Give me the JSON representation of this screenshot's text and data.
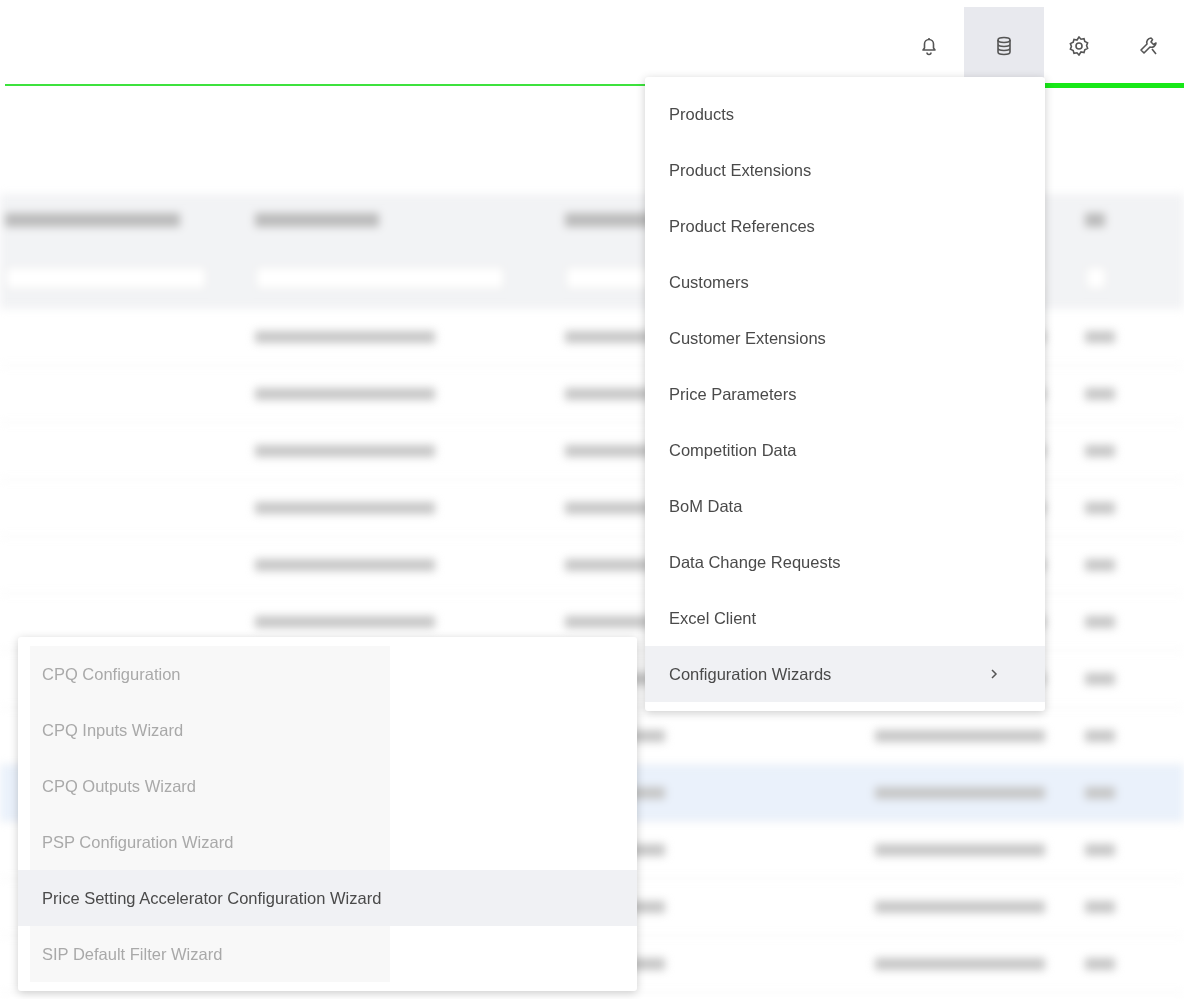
{
  "toolbar": {
    "icons": [
      {
        "kind": "bell",
        "selected": false
      },
      {
        "kind": "database",
        "selected": true
      },
      {
        "kind": "gear",
        "selected": false
      },
      {
        "kind": "wrench",
        "selected": false
      }
    ]
  },
  "data_menu": {
    "items": [
      {
        "label": "Products",
        "selected": false,
        "submenu": false
      },
      {
        "label": "Product Extensions",
        "selected": false,
        "submenu": false
      },
      {
        "label": "Product References",
        "selected": false,
        "submenu": false
      },
      {
        "label": "Customers",
        "selected": false,
        "submenu": false
      },
      {
        "label": "Customer Extensions",
        "selected": false,
        "submenu": false
      },
      {
        "label": "Price Parameters",
        "selected": false,
        "submenu": false
      },
      {
        "label": "Competition Data",
        "selected": false,
        "submenu": false
      },
      {
        "label": "BoM Data",
        "selected": false,
        "submenu": false
      },
      {
        "label": "Data Change Requests",
        "selected": false,
        "submenu": false
      },
      {
        "label": "Excel Client",
        "selected": false,
        "submenu": false
      },
      {
        "label": "Configuration Wizards",
        "selected": true,
        "submenu": true
      }
    ]
  },
  "wizards_menu": {
    "items": [
      {
        "label": "CPQ Configuration",
        "selected": false,
        "disabled": true
      },
      {
        "label": "CPQ Inputs Wizard",
        "selected": false,
        "disabled": true
      },
      {
        "label": "CPQ Outputs Wizard",
        "selected": false,
        "disabled": true
      },
      {
        "label": "PSP Configuration Wizard",
        "selected": false,
        "disabled": true
      },
      {
        "label": "Price Setting Accelerator Configuration Wizard",
        "selected": true,
        "disabled": false
      },
      {
        "label": "SIP Default Filter Wizard",
        "selected": false,
        "disabled": true
      }
    ]
  }
}
